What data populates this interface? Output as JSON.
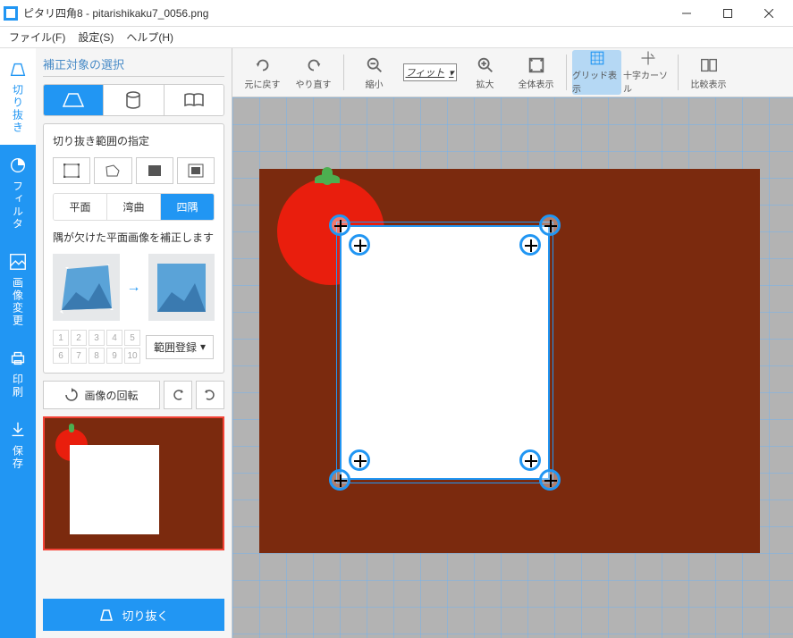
{
  "titlebar": {
    "title": "ピタリ四角8 - pitarishikaku7_0056.png"
  },
  "menubar": {
    "file": "ファイル(F)",
    "settings": "設定(S)",
    "help": "ヘルプ(H)"
  },
  "rail": {
    "crop": "切り抜き",
    "filter": "フィルタ",
    "imgchange": "画像変更",
    "print": "印刷",
    "save": "保存"
  },
  "sidebar": {
    "title": "補正対象の選択",
    "panel_title": "切り抜き範囲の指定",
    "seg": {
      "flat": "平面",
      "curved": "湾曲",
      "corners": "四隅"
    },
    "help": "隅が欠けた平面画像を補正します",
    "range_btn": "範囲登録",
    "rotate": "画像の回転",
    "nums": [
      "1",
      "2",
      "3",
      "4",
      "5",
      "6",
      "7",
      "8",
      "9",
      "10"
    ],
    "crop_button": "切り抜く"
  },
  "toolbar": {
    "undo": "元に戻す",
    "redo": "やり直す",
    "zoomout": "縮小",
    "fit": "フィット",
    "zoomin": "拡大",
    "fitall": "全体表示",
    "grid": "グリッド表示",
    "crosshair": "十字カーソル",
    "compare": "比較表示"
  }
}
